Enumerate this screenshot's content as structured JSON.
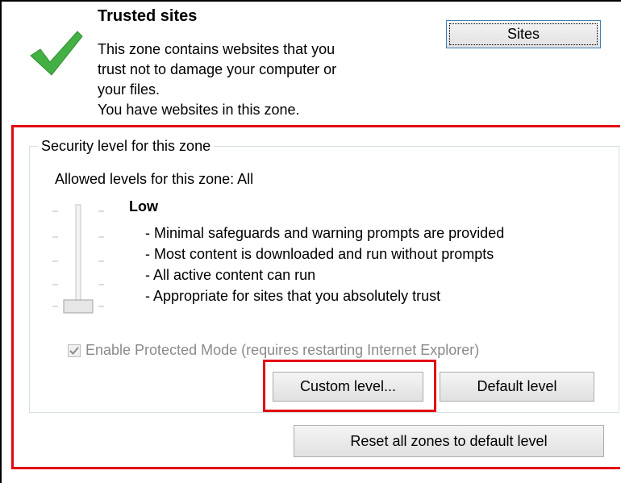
{
  "zone": {
    "title": "Trusted sites",
    "description": [
      "This zone contains websites that you",
      "trust not to damage your computer or",
      "your files.",
      "You have websites in this zone."
    ],
    "sites_button": "Sites"
  },
  "security": {
    "group_label": "Security level for this zone",
    "allowed_levels": "Allowed levels for this zone: All",
    "level_name": "Low",
    "level_bullets": [
      "- Minimal safeguards and warning prompts are provided",
      "- Most content is downloaded and run without prompts",
      "- All active content can run",
      "- Appropriate for sites that you absolutely trust"
    ],
    "protected_mode_label": "Enable Protected Mode (requires restarting Internet Explorer)",
    "protected_mode_checked": true,
    "custom_level_button": "Custom level...",
    "default_level_button": "Default level"
  },
  "reset_button": "Reset all zones to default level",
  "colors": {
    "highlight_red": "#e30613",
    "check_green": "#3aa53a"
  }
}
